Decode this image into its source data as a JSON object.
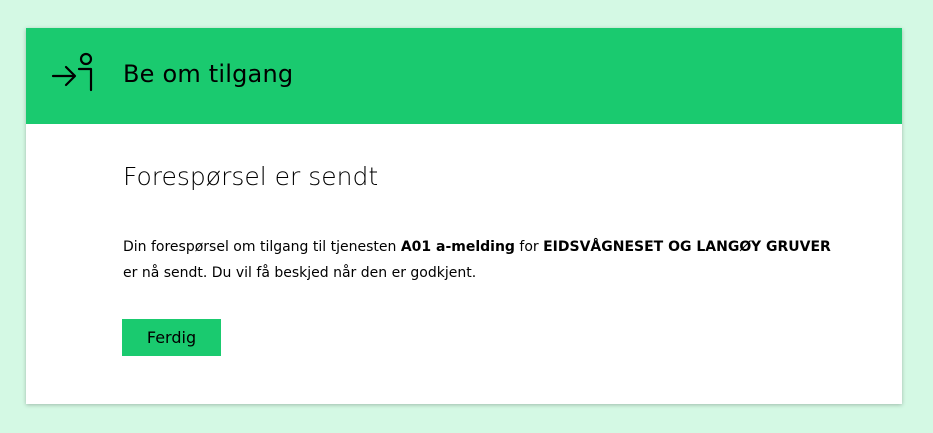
{
  "colors": {
    "page_background": "#d4f9e4",
    "accent": "#1aca6f",
    "surface": "#ffffff",
    "text": "#000000"
  },
  "header": {
    "icon": "enter-person-icon",
    "title": "Be om tilgang"
  },
  "body": {
    "heading": "Forespørsel er sendt",
    "message": {
      "part1": "Din forespørsel om tilgang til tjenesten ",
      "service": "A01 a-melding",
      "part2": " for ",
      "organization": "EIDSVÅGNESET OG LANGØY GRUVER",
      "part3": " er nå sendt. Du vil få beskjed når den er godkjent."
    },
    "done_button": "Ferdig"
  }
}
